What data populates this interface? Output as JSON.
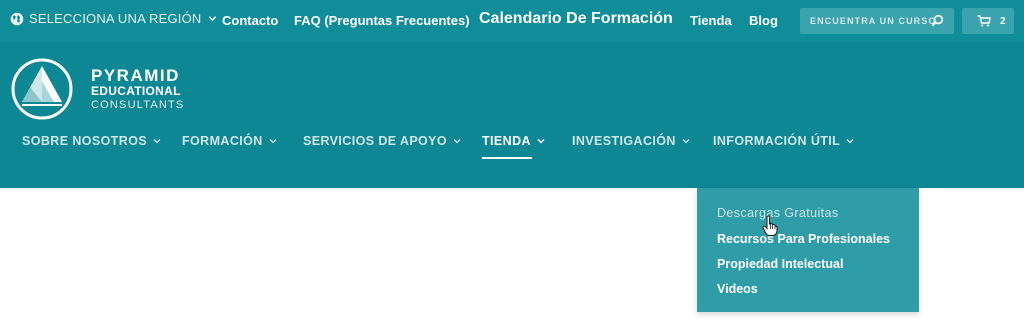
{
  "topbar": {
    "region_label": "SELECCIONA UNA REGIÓN",
    "links": {
      "contacto": "Contacto",
      "faq": "FAQ (Preguntas Frecuentes)",
      "calendario": "Calendario De Formación",
      "tienda": "Tienda",
      "blog": "Blog"
    },
    "search_placeholder": "ENCUENTRA UN CURSO",
    "cart_count": "2"
  },
  "brand": {
    "line1": "PYRAMID",
    "line2": "EDUCATIONAL",
    "line3": "CONSULTANTS"
  },
  "nav": {
    "items": [
      {
        "label": "SOBRE NOSOTROS"
      },
      {
        "label": "FORMACIÓN"
      },
      {
        "label": "SERVICIOS DE APOYO"
      },
      {
        "label": "TIENDA"
      },
      {
        "label": "INVESTIGACIÓN"
      },
      {
        "label": "INFORMACIÓN ÚTIL"
      }
    ],
    "active_item": "TIENDA"
  },
  "dropdown": {
    "items": [
      {
        "label": "Descargas Gratuitas"
      },
      {
        "label": "Recursos Para Profesionales"
      },
      {
        "label": "Propiedad Intelectual"
      },
      {
        "label": "Videos"
      }
    ],
    "hovered_item": "Descargas Gratuitas"
  },
  "colors": {
    "topbar_bg": "#0f8d99",
    "mainbar_bg": "#0e8794",
    "dropdown_bg": "#2e9da8",
    "page_bg": "#ffffff"
  }
}
